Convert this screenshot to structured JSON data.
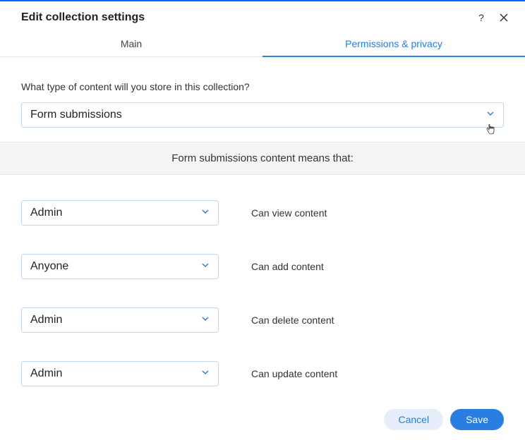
{
  "header": {
    "title": "Edit collection settings"
  },
  "tabs": {
    "main": "Main",
    "permissions": "Permissions & privacy"
  },
  "content": {
    "question": "What type of content will you store in this collection?",
    "content_type_value": "Form submissions",
    "banner": "Form submissions content means that:"
  },
  "permissions": [
    {
      "role": "Admin",
      "label": "Can view content"
    },
    {
      "role": "Anyone",
      "label": "Can add content"
    },
    {
      "role": "Admin",
      "label": "Can delete content"
    },
    {
      "role": "Admin",
      "label": "Can update content"
    }
  ],
  "footer": {
    "cancel": "Cancel",
    "save": "Save"
  }
}
